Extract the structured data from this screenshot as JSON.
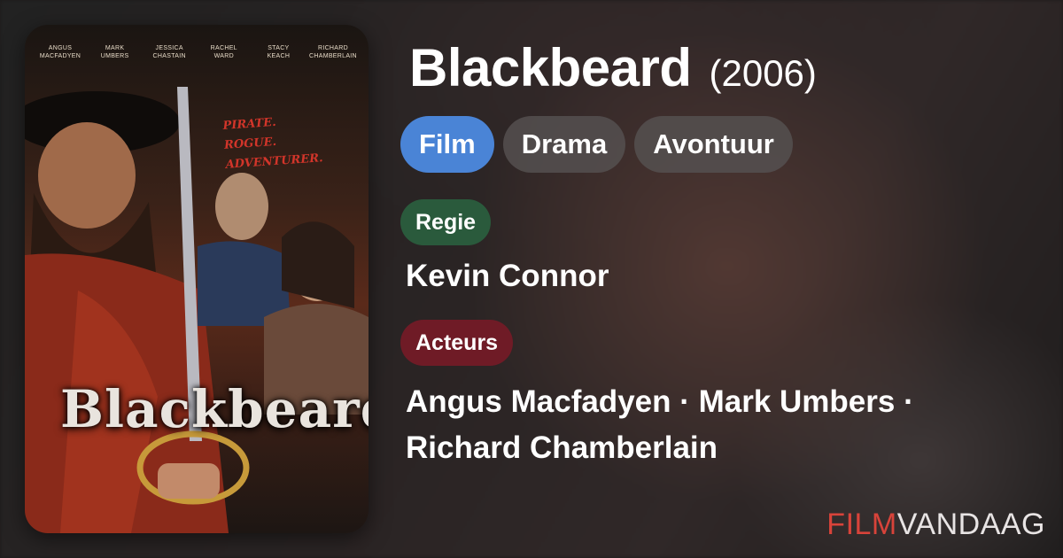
{
  "movie": {
    "title": "Blackbeard",
    "year": "(2006)"
  },
  "tags": [
    "Film",
    "Drama",
    "Avontuur"
  ],
  "director_label": "Regie",
  "director": "Kevin Connor",
  "cast_label": "Acteurs",
  "cast_line1": "Angus Macfadyen · Mark Umbers ·",
  "cast_line2": "Richard Chamberlain",
  "poster": {
    "cast_names": [
      [
        "ANGUS",
        "MACFADYEN"
      ],
      [
        "MARK",
        "UMBERS"
      ],
      [
        "JESSICA",
        "CHASTAIN"
      ],
      [
        "RACHEL",
        "WARD"
      ],
      [
        "STACY",
        "KEACH"
      ],
      [
        "RICHARD",
        "CHAMBERLAIN"
      ]
    ],
    "tagline": [
      "PIRATE.",
      "ROGUE.",
      "ADVENTURER."
    ],
    "title": "Blackbeard"
  },
  "brand": {
    "part1": "FILM",
    "part2": "VANDAAG"
  },
  "colors": {
    "film_tag": "#4a84d6",
    "regie_label": "#2a5a3c",
    "acteurs_label": "#6f1b26",
    "brand_accent": "#d8433a"
  }
}
